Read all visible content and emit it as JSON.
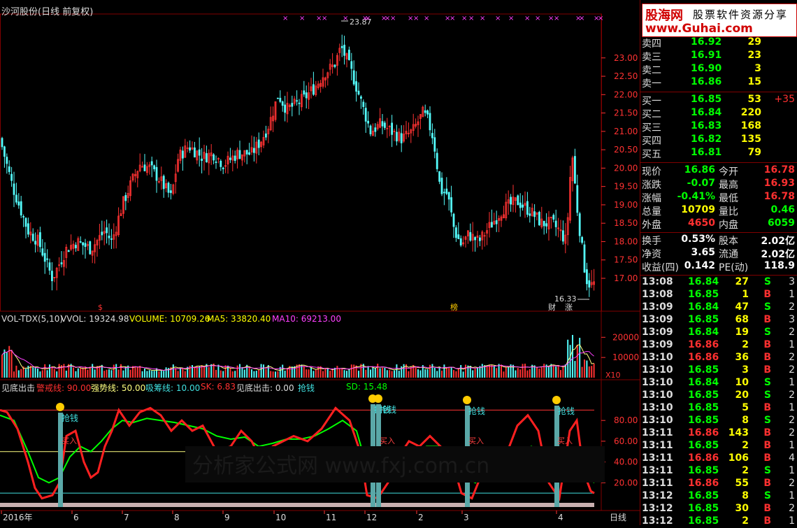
{
  "chart_title": "沙河股份(日线 前复权)",
  "watermark": "股海网 股票软件资源分享 www.Guhai.com",
  "main_chart": {
    "type": "candlestick",
    "ylim": [
      16.2,
      24.1
    ],
    "y_ticks": [
      "23.00",
      "22.50",
      "22.00",
      "21.50",
      "21.00",
      "20.50",
      "20.00",
      "19.50",
      "19.00",
      "18.50",
      "18.00",
      "17.50",
      "17.00"
    ],
    "high_annotation": "23.87",
    "low_annotation": "16.33",
    "event_marks": [
      "$",
      "榜",
      "财",
      "涨"
    ]
  },
  "vol_panel": {
    "name": "VOL-TDX(5,10)",
    "vvol": "VVOL: 19324.98",
    "volume": "VOLUME: 10709.26",
    "ma5": "MA5: 33820.40",
    "ma10": "MA10: 69213.00",
    "y_ticks": [
      "20000",
      "10000"
    ],
    "unit": "X10"
  },
  "ind_panel": {
    "name": "见底出击",
    "jingjie": "警戒线: 90.00",
    "qiangshi": "强势线: 50.00",
    "xichou": "吸筹线: 10.00",
    "sk": "SK: 6.83",
    "jiandi": "见底出击: 0.00",
    "qiangqian": "抢钱",
    "sd": "SD: 15.48",
    "y_ticks": [
      "80.00",
      "60.00",
      "40.00",
      "20.00"
    ],
    "signal_qiang": "抢钱",
    "signal_buy": "买入",
    "watermark_bar": "分析家公式网 www.fxj.com.cn"
  },
  "date_axis": [
    "2016年",
    "6",
    "7",
    "8",
    "9",
    "10",
    "11",
    "12",
    "2",
    "3",
    "4"
  ],
  "period": "日线",
  "order_book": {
    "sell": [
      {
        "label": "卖四",
        "price": "16.92",
        "vol": "29"
      },
      {
        "label": "卖三",
        "price": "16.91",
        "vol": "23"
      },
      {
        "label": "卖二",
        "price": "16.90",
        "vol": "3"
      },
      {
        "label": "卖一",
        "price": "16.86",
        "vol": "15"
      }
    ],
    "buy": [
      {
        "label": "买一",
        "price": "16.85",
        "vol": "53",
        "chg": "+35"
      },
      {
        "label": "买二",
        "price": "16.84",
        "vol": "220",
        "chg": ""
      },
      {
        "label": "买三",
        "price": "16.83",
        "vol": "168",
        "chg": ""
      },
      {
        "label": "买四",
        "price": "16.82",
        "vol": "135",
        "chg": ""
      },
      {
        "label": "买五",
        "price": "16.81",
        "vol": "79",
        "chg": ""
      }
    ]
  },
  "stats": [
    {
      "l1": "现价",
      "v1": "16.86",
      "l2": "今开",
      "v2": "16.78",
      "c1": "#00ff00",
      "c2": "#ff3030"
    },
    {
      "l1": "涨跌",
      "v1": "-0.07",
      "l2": "最高",
      "v2": "16.93",
      "c1": "#00ff00",
      "c2": "#ff3030"
    },
    {
      "l1": "涨幅",
      "v1": "-0.41%",
      "l2": "最低",
      "v2": "16.78",
      "c1": "#00ff00",
      "c2": "#ff3030"
    },
    {
      "l1": "总量",
      "v1": "10709",
      "l2": "量比",
      "v2": "0.46",
      "c1": "#ffff00",
      "c2": "#00ff00"
    },
    {
      "l1": "外盘",
      "v1": "4650",
      "l2": "内盘",
      "v2": "6059",
      "c1": "#ff3030",
      "c2": "#00ff00"
    },
    {
      "l1": "换手",
      "v1": "0.53%",
      "l2": "股本",
      "v2": "2.02亿",
      "c1": "#ffffff",
      "c2": "#ffffff"
    },
    {
      "l1": "净资",
      "v1": "3.65",
      "l2": "流通",
      "v2": "2.02亿",
      "c1": "#ffffff",
      "c2": "#ffffff"
    },
    {
      "l1": "收益(四)",
      "v1": "0.142",
      "l2": "PE(动)",
      "v2": "118.9",
      "c1": "#ffffff",
      "c2": "#ffffff"
    }
  ],
  "ticks": [
    {
      "t": "13:08",
      "p": "16.84",
      "v": "27",
      "d": "S",
      "n": "3"
    },
    {
      "t": "13:08",
      "p": "16.85",
      "v": "1",
      "d": "B",
      "n": "1"
    },
    {
      "t": "13:09",
      "p": "16.84",
      "v": "47",
      "d": "S",
      "n": "2"
    },
    {
      "t": "13:09",
      "p": "16.85",
      "v": "68",
      "d": "B",
      "n": "3"
    },
    {
      "t": "13:09",
      "p": "16.84",
      "v": "19",
      "d": "S",
      "n": "2"
    },
    {
      "t": "13:09",
      "p": "16.86",
      "v": "2",
      "d": "B",
      "n": "1"
    },
    {
      "t": "13:10",
      "p": "16.86",
      "v": "36",
      "d": "B",
      "n": "2"
    },
    {
      "t": "13:10",
      "p": "16.85",
      "v": "3",
      "d": "B",
      "n": "2"
    },
    {
      "t": "13:10",
      "p": "16.84",
      "v": "10",
      "d": "S",
      "n": "1"
    },
    {
      "t": "13:10",
      "p": "16.85",
      "v": "20",
      "d": "S",
      "n": "2"
    },
    {
      "t": "13:10",
      "p": "16.85",
      "v": "5",
      "d": "B",
      "n": "1"
    },
    {
      "t": "13:10",
      "p": "16.85",
      "v": "8",
      "d": "S",
      "n": "2"
    },
    {
      "t": "13:11",
      "p": "16.86",
      "v": "143",
      "d": "B",
      "n": "2"
    },
    {
      "t": "13:11",
      "p": "16.85",
      "v": "2",
      "d": "B",
      "n": "1"
    },
    {
      "t": "13:11",
      "p": "16.86",
      "v": "106",
      "d": "B",
      "n": "4"
    },
    {
      "t": "13:11",
      "p": "16.85",
      "v": "2",
      "d": "S",
      "n": "1"
    },
    {
      "t": "13:11",
      "p": "16.86",
      "v": "55",
      "d": "B",
      "n": "2"
    },
    {
      "t": "13:12",
      "p": "16.85",
      "v": "8",
      "d": "S",
      "n": "1"
    },
    {
      "t": "13:12",
      "p": "16.85",
      "v": "30",
      "d": "B",
      "n": "2"
    },
    {
      "t": "13:12",
      "p": "16.85",
      "v": "2",
      "d": "B",
      "n": "1"
    }
  ]
}
